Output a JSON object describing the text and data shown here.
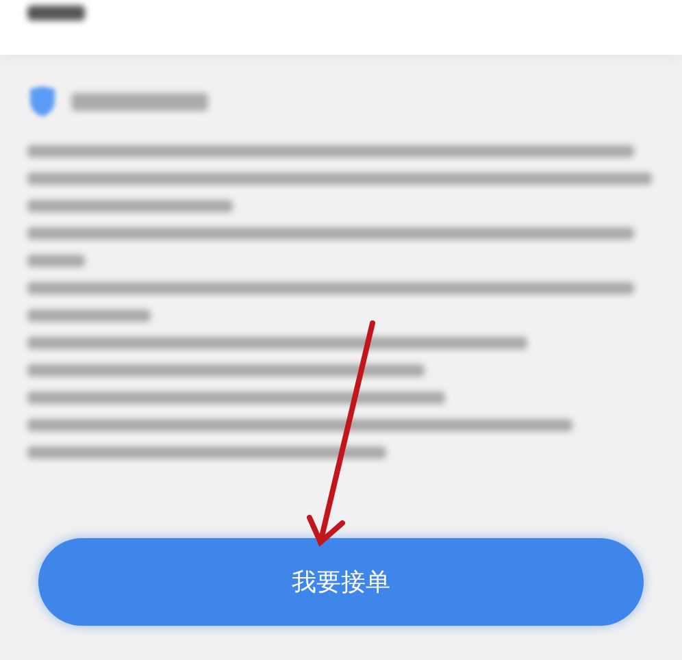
{
  "submit_button": {
    "label": "我要接单"
  }
}
